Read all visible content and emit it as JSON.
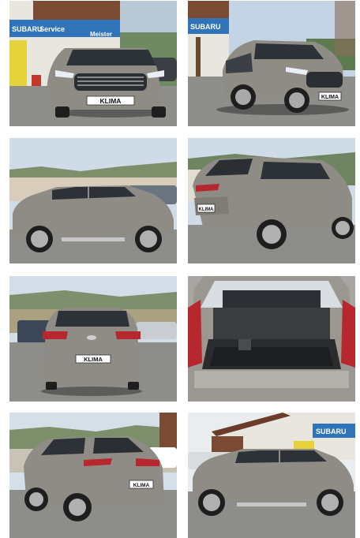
{
  "gallery": {
    "photos": [
      {
        "view": "front",
        "plate": "KLIMA",
        "sign_left": "SUBARU",
        "sign_mid": "Service",
        "sign_right": "Meister"
      },
      {
        "view": "front-right three-quarter",
        "plate": "KLIMA",
        "sign_left": "SUBARU"
      },
      {
        "view": "left side",
        "plate": ""
      },
      {
        "view": "rear-left three-quarter",
        "plate": "KLIMA"
      },
      {
        "view": "rear",
        "plate": "KLIMA"
      },
      {
        "view": "open boot",
        "plate": ""
      },
      {
        "view": "rear-left three-quarter low",
        "plate": "KLIMA"
      },
      {
        "view": "left side",
        "plate": "",
        "sign_right": "SUBARU"
      }
    ],
    "car_color": "#8f8c85",
    "sign_color": "#2f73b8"
  }
}
